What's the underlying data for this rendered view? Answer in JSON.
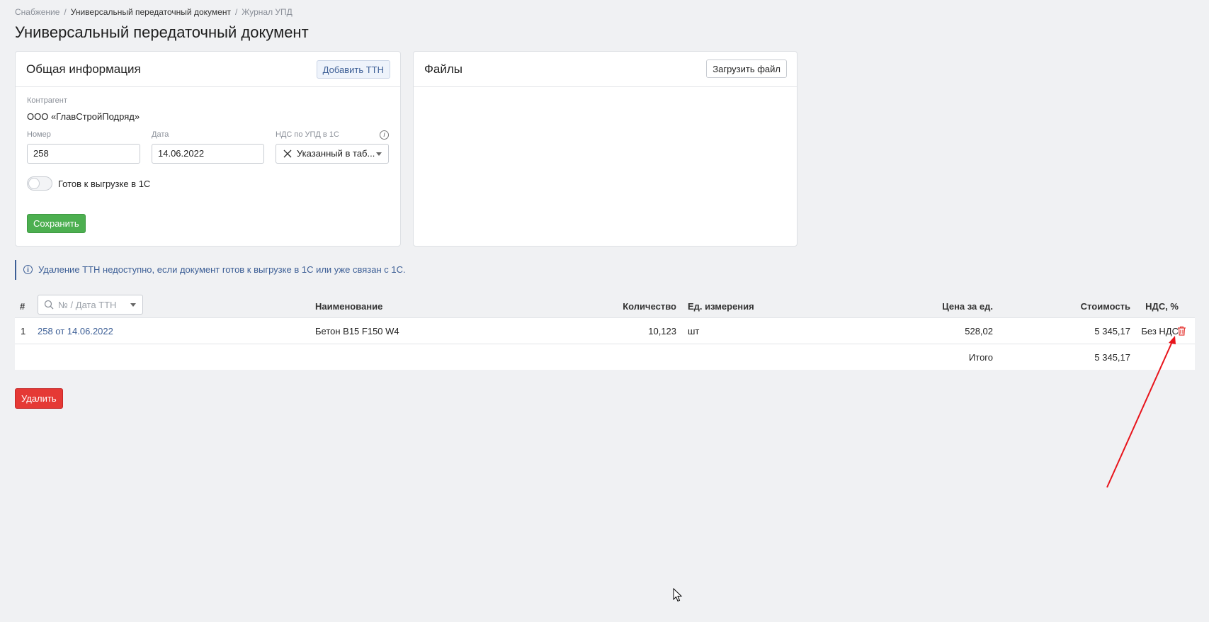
{
  "breadcrumb": {
    "items": [
      "Снабжение",
      "Универсальный передаточный документ",
      "Журнал УПД"
    ],
    "separator": "/"
  },
  "page_title": "Универсальный передаточный документ",
  "general_info": {
    "title": "Общая информация",
    "add_ttn_label": "Добавить ТТН",
    "counterparty_label": "Контрагент",
    "counterparty_value": "ООО «ГлавСтройПодряд»",
    "number_label": "Номер",
    "number_value": "258",
    "date_label": "Дата",
    "date_value": "14.06.2022",
    "vat_label": "НДС по УПД в 1С",
    "vat_value": "Указанный в таб...",
    "ready_toggle_label": "Готов к выгрузке в 1С",
    "ready_toggle_on": false,
    "save_label": "Сохранить"
  },
  "files": {
    "title": "Файлы",
    "upload_label": "Загрузить файл"
  },
  "notice": "Удаление ТТН недоступно, если документ готов к выгрузке в 1С или уже связан с 1С.",
  "table": {
    "headers": {
      "num": "#",
      "filter_placeholder": "№ / Дата ТТН",
      "name": "Наименование",
      "qty": "Количество",
      "unit": "Ед. измерения",
      "price": "Цена за ед.",
      "cost": "Стоимость",
      "vat": "НДС, %"
    },
    "rows": [
      {
        "num": "1",
        "ttn": "258 от 14.06.2022",
        "name": "Бетон B15 F150 W4",
        "qty": "10,123",
        "unit": "шт",
        "price": "528,02",
        "cost": "5 345,17",
        "vat": "Без НДС"
      }
    ],
    "total_label": "Итого",
    "total_value": "5 345,17"
  },
  "delete_label": "Удалить",
  "colors": {
    "accent": "#3d5f96",
    "success": "#4caf50",
    "danger": "#e53935",
    "annotation": "#e8141b"
  }
}
